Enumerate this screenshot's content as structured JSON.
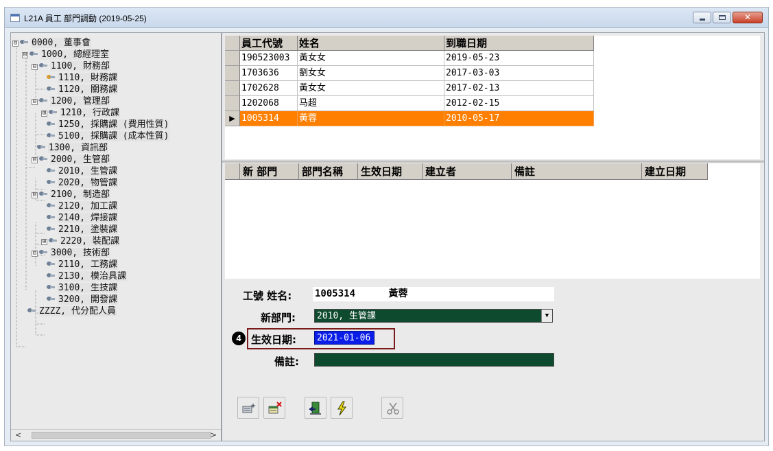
{
  "window": {
    "title": "L21A 員工 部門調動 (2019-05-25)",
    "close_glyph": "✕"
  },
  "tree": {
    "nodes": [
      {
        "label": "0000, 董事會",
        "expander": "⊟"
      },
      {
        "label": "1000, 總經理室",
        "expander": "⊟"
      },
      {
        "label": "1100, 財務部",
        "expander": "⊟"
      },
      {
        "label": "1110, 財務課",
        "expander": ""
      },
      {
        "label": "1120, 關務課",
        "expander": ""
      },
      {
        "label": "1200, 管理部",
        "expander": "⊟"
      },
      {
        "label": "1210, 行政課",
        "expander": "⊞"
      },
      {
        "label": "1250, 採購課 (費用性質)",
        "expander": ""
      },
      {
        "label": "5100, 採購課 (成本性質)",
        "expander": ""
      },
      {
        "label": "1300, 資訊部",
        "expander": ""
      },
      {
        "label": "2000, 生管部",
        "expander": "⊟"
      },
      {
        "label": "2010, 生管課",
        "expander": ""
      },
      {
        "label": "2020, 物管課",
        "expander": ""
      },
      {
        "label": "2100, 制造部",
        "expander": "⊟"
      },
      {
        "label": "2120, 加工課",
        "expander": ""
      },
      {
        "label": "2140, 焊接課",
        "expander": ""
      },
      {
        "label": "2210, 塗裝課",
        "expander": ""
      },
      {
        "label": "2220, 裝配課",
        "expander": "⊞"
      },
      {
        "label": "3000, 技術部",
        "expander": "⊟"
      },
      {
        "label": "2110, 工務課",
        "expander": ""
      },
      {
        "label": "2130, 模治具課",
        "expander": ""
      },
      {
        "label": "3100, 生技課",
        "expander": ""
      },
      {
        "label": "3200, 開發課",
        "expander": ""
      },
      {
        "label": "ZZZZ, 代分配人員",
        "expander": ""
      }
    ],
    "scroll_left": "<",
    "scroll_right": ">"
  },
  "employee_grid": {
    "indicator": "▶",
    "columns": [
      "員工代號",
      "姓名",
      "到職日期"
    ],
    "rows": [
      [
        "190523003",
        "黃女女",
        "2019-05-23"
      ],
      [
        "1703636",
        "劉女女",
        "2017-03-03"
      ],
      [
        "1702628",
        "黃女女",
        "2017-02-13"
      ],
      [
        "1202068",
        "马超",
        "2012-02-15"
      ],
      [
        "1005314",
        "黃蓉",
        "2010-05-17"
      ]
    ],
    "selected_index": 4
  },
  "history_grid": {
    "columns": [
      "新 部門",
      "部門名稱",
      "生效日期",
      "建立者",
      "備註",
      "建立日期"
    ]
  },
  "form": {
    "emp_label": "工號 姓名:",
    "emp_id": "1005314",
    "emp_name": "黃蓉",
    "dept_label": "新部門:",
    "dept_value": "2010, 生管課",
    "dropdown_glyph": "▼",
    "effective_label": "生效日期:",
    "effective_value": "2021-01-06",
    "note_label": "備註:",
    "note_value": "",
    "step_number": "4"
  },
  "colors": {
    "selected_row": "#ff7f00",
    "dept_field": "#0e4a2e",
    "date_field": "#0a1ee8",
    "highlight_border": "#7a1a1a"
  },
  "toolbar": {
    "buttons": [
      "add-record-icon",
      "delete-record-icon",
      "exit-icon",
      "execute-icon",
      "cut-icon"
    ]
  }
}
